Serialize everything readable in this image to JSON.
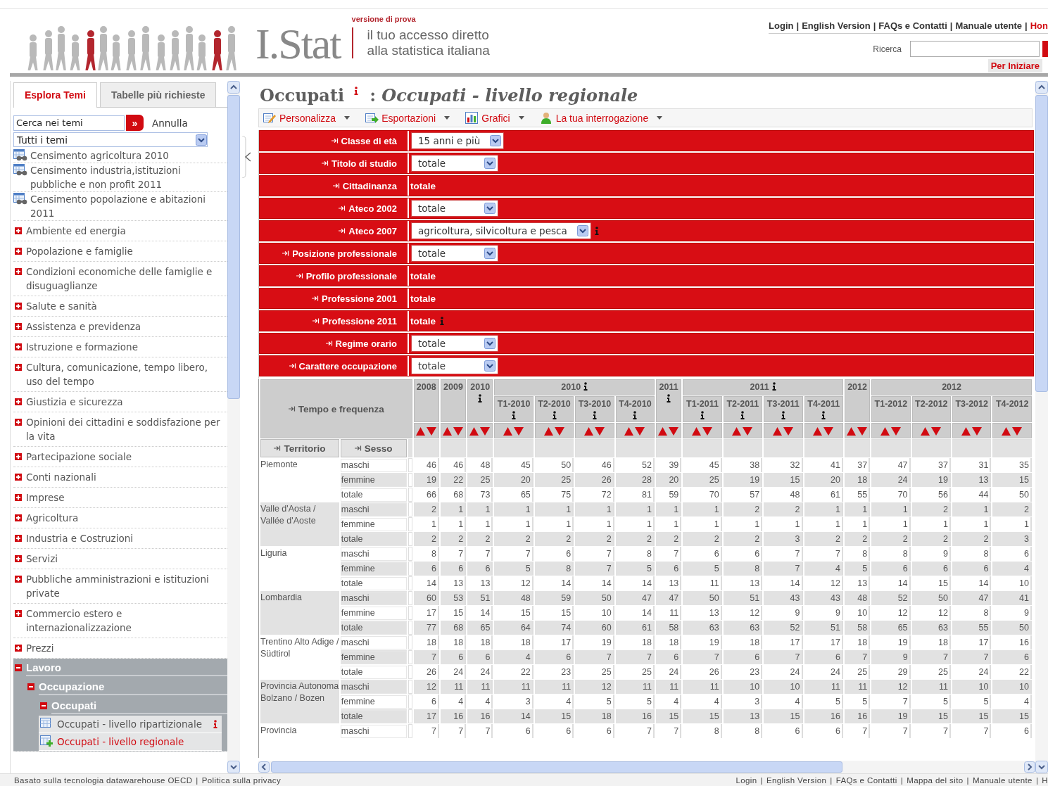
{
  "header": {
    "logo_text": "I.Stat",
    "version_note": "versione di prova",
    "tagline": [
      "il tuo accesso diretto",
      "alla statistica italiana"
    ],
    "separator": "|",
    "top_links": [
      {
        "label": "Login",
        "selected": false
      },
      {
        "label": "English Version",
        "selected": false
      },
      {
        "label": "FAQs e Contatti",
        "selected": false
      },
      {
        "label": "Manuale utente",
        "selected": false
      },
      {
        "label": "Hon",
        "selected": true
      }
    ],
    "search_label": "Ricerca",
    "start_button": "Per Iniziare"
  },
  "sidebar": {
    "tabs": [
      {
        "label": "Esplora Temi",
        "selected": true
      },
      {
        "label": "Tabelle più richieste",
        "selected": false
      }
    ],
    "search": {
      "value": "Cerca nei temi"
    },
    "search_button": "»",
    "cancel_link": "Annulla",
    "theme_select": "Tutti i temi",
    "items": [
      {
        "label": "Censimento agricoltura 2010",
        "kind": "census"
      },
      {
        "label": "Censimento industria,istituzioni pubbliche e non profit 2011",
        "kind": "census"
      },
      {
        "label": "Censimento popolazione e abitazioni 2011",
        "kind": "census"
      },
      {
        "label": "Ambiente ed energia",
        "kind": "topic",
        "expanded": false
      },
      {
        "label": "Popolazione e famiglie",
        "kind": "topic",
        "expanded": false
      },
      {
        "label": "Condizioni economiche delle famiglie e disuguaglianze",
        "kind": "topic",
        "expanded": false
      },
      {
        "label": "Salute e sanità",
        "kind": "topic",
        "expanded": false
      },
      {
        "label": "Assistenza e previdenza",
        "kind": "topic",
        "expanded": false
      },
      {
        "label": "Istruzione e formazione",
        "kind": "topic",
        "expanded": false
      },
      {
        "label": "Cultura, comunicazione, tempo libero, uso del tempo",
        "kind": "topic",
        "expanded": false
      },
      {
        "label": "Giustizia e sicurezza",
        "kind": "topic",
        "expanded": false
      },
      {
        "label": "Opinioni dei cittadini e soddisfazione per la vita",
        "kind": "topic",
        "expanded": false
      },
      {
        "label": "Partecipazione sociale",
        "kind": "topic",
        "expanded": false
      },
      {
        "label": "Conti nazionali",
        "kind": "topic",
        "expanded": false
      },
      {
        "label": "Imprese",
        "kind": "topic",
        "expanded": false
      },
      {
        "label": "Agricoltura",
        "kind": "topic",
        "expanded": false
      },
      {
        "label": "Industria e Costruzioni",
        "kind": "topic",
        "expanded": false
      },
      {
        "label": "Servizi",
        "kind": "topic",
        "expanded": false
      },
      {
        "label": "Pubbliche amministrazioni e istituzioni private",
        "kind": "topic",
        "expanded": false
      },
      {
        "label": "Commercio estero e internazionalizzazione",
        "kind": "topic",
        "expanded": false
      },
      {
        "label": "Prezzi",
        "kind": "topic",
        "expanded": false
      },
      {
        "label": "Lavoro",
        "kind": "topic",
        "expanded": true,
        "children": [
          {
            "label": "Occupazione",
            "kind": "topic",
            "expanded": true,
            "children": [
              {
                "label": "Occupati",
                "kind": "topic",
                "expanded": true,
                "children": [
                  {
                    "label": "Occupati - livello ripartizionale",
                    "kind": "table",
                    "info": true,
                    "selected": false
                  },
                  {
                    "label": "Occupati - livello regionale",
                    "kind": "table",
                    "info": false,
                    "selected": true
                  }
                ]
              }
            ]
          }
        ]
      }
    ]
  },
  "main": {
    "title": "Occupati",
    "title_info": true,
    "subtitle": ": *Occupati - livello regionale*",
    "toolbar": [
      {
        "label": "Personalizza",
        "kind": "customize"
      },
      {
        "label": "Esportazioni",
        "kind": "export"
      },
      {
        "label": "Grafici",
        "kind": "chart"
      },
      {
        "label": "La tua interrogazione",
        "kind": "query"
      }
    ],
    "filters": [
      {
        "label": "Classe di età",
        "kind": "select",
        "value": "15 anni e più",
        "info": false
      },
      {
        "label": "Titolo di studio",
        "kind": "select",
        "value": "totale",
        "info": false
      },
      {
        "label": "Cittadinanza",
        "kind": "text",
        "value": "totale",
        "info": false
      },
      {
        "label": "Ateco 2002",
        "kind": "select",
        "value": "totale",
        "info": false
      },
      {
        "label": "Ateco 2007",
        "kind": "select",
        "value": "agricoltura, silvicoltura e pesca",
        "info": true
      },
      {
        "label": "Posizione professionale",
        "kind": "select",
        "value": "totale",
        "info": false
      },
      {
        "label": "Profilo professionale",
        "kind": "text",
        "value": "totale",
        "info": false
      },
      {
        "label": "Professione 2001",
        "kind": "text",
        "value": "totale",
        "info": false
      },
      {
        "label": "Professione 2011",
        "kind": "text",
        "value": "totale",
        "info": true
      },
      {
        "label": "Regime orario",
        "kind": "select",
        "value": "totale",
        "info": false
      },
      {
        "label": "Carattere occupazione",
        "kind": "select",
        "value": "totale",
        "info": false
      }
    ],
    "table": {
      "corner_label": "Tempo e frequenza",
      "row_headers": [
        "Territorio",
        "Sesso"
      ],
      "column_groups": [
        {
          "label": "2008",
          "info": false
        },
        {
          "label": "2009",
          "info": false
        },
        {
          "label": "2010",
          "info": true
        },
        {
          "label": "2010",
          "info": true,
          "periods": [
            {
              "label": "T1-2010",
              "info": true
            },
            {
              "label": "T2-2010",
              "info": true
            },
            {
              "label": "T3-2010",
              "info": true
            },
            {
              "label": "T4-2010",
              "info": true
            }
          ]
        },
        {
          "label": "2011",
          "info": true
        },
        {
          "label": "2011",
          "info": true,
          "periods": [
            {
              "label": "T1-2011",
              "info": true
            },
            {
              "label": "T2-2011",
              "info": true
            },
            {
              "label": "T3-2011",
              "info": true
            },
            {
              "label": "T4-2011",
              "info": true
            }
          ]
        },
        {
          "label": "2012",
          "info": false
        },
        {
          "label": "2012",
          "info": false,
          "periods": [
            {
              "label": "T1-2012",
              "info": false
            },
            {
              "label": "T2-2012",
              "info": false
            },
            {
              "label": "T3-2012",
              "info": false
            },
            {
              "label": "T4-2012",
              "info": false
            }
          ]
        }
      ],
      "rows": [
        {
          "region": "Piemonte",
          "cells": [
            {
              "sex": "maschi",
              "values": [
                "46",
                "46",
                "48",
                "45",
                "50",
                "46",
                "52",
                "39",
                "45",
                "38",
                "32",
                "41",
                "37",
                "47",
                "37",
                "31",
                "35"
              ]
            },
            {
              "sex": "femmine",
              "values": [
                "19",
                "22",
                "25",
                "20",
                "25",
                "26",
                "28",
                "20",
                "25",
                "19",
                "15",
                "20",
                "18",
                "24",
                "19",
                "13",
                "15"
              ]
            },
            {
              "sex": "totale",
              "values": [
                "66",
                "68",
                "73",
                "65",
                "75",
                "72",
                "81",
                "59",
                "70",
                "57",
                "48",
                "61",
                "55",
                "70",
                "56",
                "44",
                "50"
              ]
            }
          ]
        },
        {
          "region": "Valle d'Aosta / Vallée d'Aoste",
          "cells": [
            {
              "sex": "maschi",
              "values": [
                "2",
                "1",
                "1",
                "1",
                "1",
                "1",
                "1",
                "1",
                "1",
                "2",
                "2",
                "1",
                "1",
                "1",
                "2",
                "1",
                "2"
              ]
            },
            {
              "sex": "femmine",
              "values": [
                "1",
                "1",
                "1",
                "1",
                "1",
                "1",
                "1",
                "1",
                "1",
                "1",
                "1",
                "1",
                "1",
                "1",
                "1",
                "1",
                "1"
              ]
            },
            {
              "sex": "totale",
              "values": [
                "2",
                "2",
                "2",
                "2",
                "2",
                "2",
                "2",
                "2",
                "2",
                "2",
                "3",
                "2",
                "2",
                "2",
                "2",
                "2",
                "3"
              ]
            }
          ]
        },
        {
          "region": "Liguria",
          "cells": [
            {
              "sex": "maschi",
              "values": [
                "8",
                "7",
                "7",
                "7",
                "6",
                "7",
                "8",
                "7",
                "6",
                "6",
                "7",
                "7",
                "8",
                "8",
                "9",
                "8",
                "6"
              ]
            },
            {
              "sex": "femmine",
              "values": [
                "6",
                "6",
                "6",
                "5",
                "8",
                "7",
                "5",
                "6",
                "5",
                "8",
                "7",
                "4",
                "5",
                "6",
                "6",
                "6",
                "4"
              ]
            },
            {
              "sex": "totale",
              "values": [
                "14",
                "13",
                "13",
                "12",
                "14",
                "14",
                "14",
                "13",
                "11",
                "13",
                "14",
                "12",
                "13",
                "14",
                "15",
                "14",
                "10"
              ]
            }
          ]
        },
        {
          "region": "Lombardia",
          "cells": [
            {
              "sex": "maschi",
              "values": [
                "60",
                "53",
                "51",
                "48",
                "59",
                "50",
                "47",
                "47",
                "50",
                "51",
                "43",
                "43",
                "48",
                "52",
                "50",
                "47",
                "41"
              ]
            },
            {
              "sex": "femmine",
              "values": [
                "17",
                "15",
                "14",
                "15",
                "15",
                "10",
                "14",
                "11",
                "13",
                "12",
                "9",
                "9",
                "10",
                "12",
                "12",
                "8",
                "9"
              ]
            },
            {
              "sex": "totale",
              "values": [
                "77",
                "68",
                "65",
                "64",
                "74",
                "60",
                "61",
                "58",
                "63",
                "63",
                "52",
                "51",
                "58",
                "65",
                "63",
                "55",
                "50"
              ]
            }
          ]
        },
        {
          "region": "Trentino Alto Adige / Südtirol",
          "cells": [
            {
              "sex": "maschi",
              "values": [
                "18",
                "18",
                "18",
                "18",
                "17",
                "19",
                "18",
                "18",
                "19",
                "18",
                "17",
                "17",
                "18",
                "19",
                "18",
                "17",
                "16"
              ]
            },
            {
              "sex": "femmine",
              "values": [
                "7",
                "6",
                "6",
                "4",
                "6",
                "7",
                "7",
                "6",
                "7",
                "6",
                "7",
                "6",
                "7",
                "9",
                "7",
                "7",
                "6"
              ]
            },
            {
              "sex": "totale",
              "values": [
                "26",
                "24",
                "24",
                "22",
                "23",
                "25",
                "25",
                "24",
                "26",
                "23",
                "24",
                "24",
                "25",
                "29",
                "25",
                "24",
                "22"
              ]
            }
          ]
        },
        {
          "region": "Provincia Autonoma Bolzano / Bozen",
          "cells": [
            {
              "sex": "maschi",
              "values": [
                "12",
                "11",
                "11",
                "11",
                "11",
                "12",
                "11",
                "11",
                "11",
                "10",
                "10",
                "11",
                "11",
                "12",
                "11",
                "10",
                "10"
              ]
            },
            {
              "sex": "femmine",
              "values": [
                "6",
                "4",
                "4",
                "3",
                "4",
                "5",
                "5",
                "4",
                "4",
                "3",
                "4",
                "5",
                "5",
                "7",
                "5",
                "5",
                "4"
              ]
            },
            {
              "sex": "totale",
              "values": [
                "17",
                "16",
                "16",
                "14",
                "15",
                "18",
                "16",
                "15",
                "15",
                "13",
                "15",
                "16",
                "16",
                "19",
                "15",
                "15",
                "15"
              ]
            }
          ]
        },
        {
          "region": "Provincia",
          "cells": [
            {
              "sex": "maschi",
              "values": [
                "7",
                "7",
                "7",
                "6",
                "6",
                "6",
                "7",
                "7",
                "8",
                "8",
                "6",
                "6",
                "7",
                "7",
                "7",
                "7",
                "6"
              ]
            }
          ]
        }
      ]
    }
  },
  "footer": {
    "separator": "|",
    "left": [
      "Basato sulla tecnologia datawarehouse OECD",
      "Politica sulla privacy"
    ],
    "right": [
      "Login",
      "English Version",
      "FAQs e Contatti",
      "Mappa del sito",
      "Manuale utente",
      "H"
    ]
  }
}
